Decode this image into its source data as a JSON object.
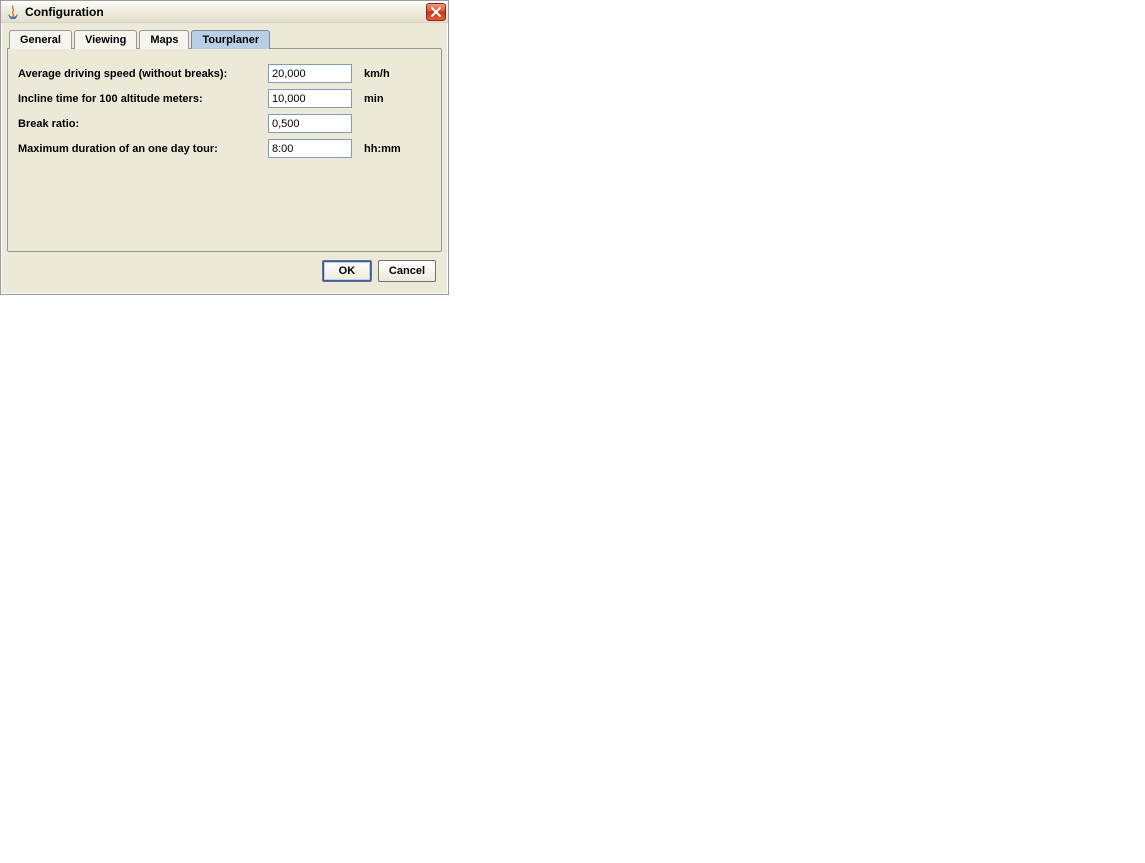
{
  "window": {
    "title": "Configuration"
  },
  "tabs": {
    "general": "General",
    "viewing": "Viewing",
    "maps": "Maps",
    "tourplaner": "Tourplaner"
  },
  "form": {
    "speed": {
      "label": "Average driving speed (without breaks):",
      "value": "20,000",
      "unit": "km/h"
    },
    "incline": {
      "label": "Incline time for 100 altitude meters:",
      "value": "10,000",
      "unit": "min"
    },
    "break": {
      "label": "Break ratio:",
      "value": "0,500",
      "unit": ""
    },
    "maxduration": {
      "label": "Maximum duration of an one day tour:",
      "value": "8:00",
      "unit": "hh:mm"
    }
  },
  "buttons": {
    "ok": "OK",
    "cancel": "Cancel"
  }
}
